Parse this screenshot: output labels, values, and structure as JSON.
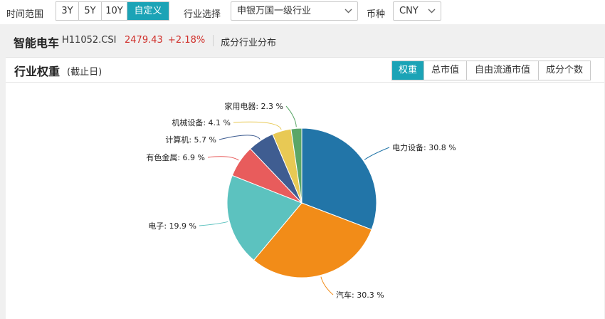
{
  "toolbar": {
    "time_range_label": "时间范围",
    "time_buttons": [
      "3Y",
      "5Y",
      "10Y",
      "自定义"
    ],
    "time_active_index": 3,
    "industry_label": "行业选择",
    "industry_value": "申银万国一级行业",
    "currency_label": "币种",
    "currency_value": "CNY"
  },
  "index": {
    "name": "智能电车",
    "code": "H11052.CSI",
    "price": "2479.43",
    "change": "+2.18%",
    "tab": "成分行业分布"
  },
  "panel": {
    "title": "行业权重",
    "subtitle": "(截止日)",
    "tabs": [
      "权重",
      "总市值",
      "自由流通市值",
      "成分个数"
    ],
    "active_tab_index": 0
  },
  "chart_data": {
    "type": "pie",
    "title": "",
    "slices": [
      {
        "label": "电力设备",
        "value": 30.8,
        "display": "30.8 %",
        "color": "#2275a8"
      },
      {
        "label": "汽车",
        "value": 30.3,
        "display": "30.3 %",
        "color": "#f28c18"
      },
      {
        "label": "电子",
        "value": 19.9,
        "display": "19.9 %",
        "color": "#5cc2bf"
      },
      {
        "label": "有色金属",
        "value": 6.9,
        "display": "6.9 %",
        "color": "#e85c5c"
      },
      {
        "label": "计算机",
        "value": 5.7,
        "display": "5.7 %",
        "color": "#3f5d91"
      },
      {
        "label": "机械设备",
        "value": 4.1,
        "display": "4.1 %",
        "color": "#e8c954"
      },
      {
        "label": "家用电器",
        "value": 2.3,
        "display": "2.3 %",
        "color": "#5aa667"
      }
    ]
  }
}
